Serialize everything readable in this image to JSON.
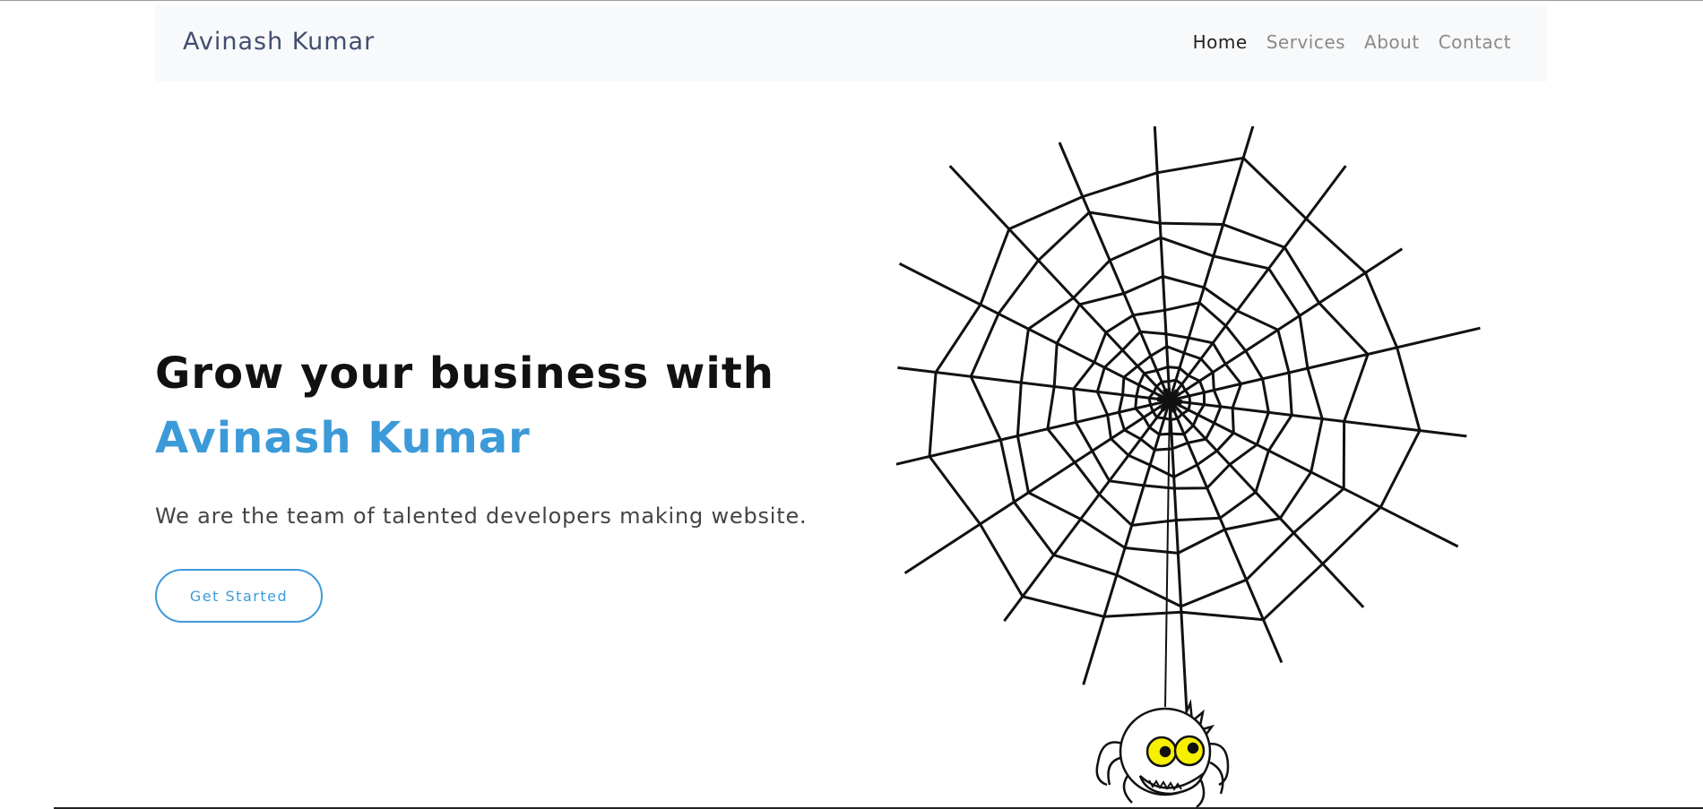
{
  "navbar": {
    "brand": "Avinash Kumar",
    "links": [
      {
        "label": "Home",
        "active": true
      },
      {
        "label": "Services",
        "active": false
      },
      {
        "label": "About",
        "active": false
      },
      {
        "label": "Contact",
        "active": false
      }
    ]
  },
  "hero": {
    "line1": "Grow your business with",
    "line2": "Avinash Kumar",
    "subtitle": "We are the team of talented developers making website.",
    "cta_label": "Get Started",
    "illustration": "spider-web-icon"
  },
  "colors": {
    "accent": "#3d9ad8",
    "brand_text": "#434d70",
    "navbar_bg": "#f8f9fa",
    "spider_eyes": "#f6f000"
  }
}
